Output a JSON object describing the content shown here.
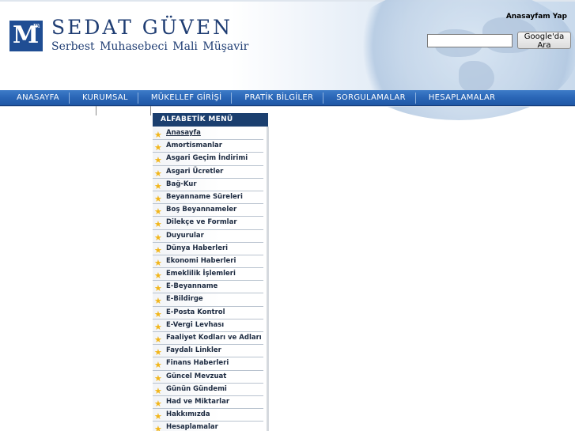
{
  "header": {
    "logo_letter": "M",
    "logo_sup": "m",
    "brand_name": "SEDAT GÜVEN",
    "tagline": "Serbest Muhasebeci Mali Müşavir",
    "homepage_link": "Anasayfam Yap",
    "search": {
      "value": "",
      "placeholder": "",
      "button_label": "Google'da Ara"
    }
  },
  "nav": {
    "items": [
      {
        "label": "ANASAYFA"
      },
      {
        "label": "KURUMSAL"
      },
      {
        "label": "MÜKELLEF GİRİŞİ"
      },
      {
        "label": "PRATİK BİLGİLER"
      },
      {
        "label": "SORGULAMALAR"
      },
      {
        "label": "HESAPLAMALAR"
      }
    ]
  },
  "menu": {
    "title": "ALFABETİK MENÜ",
    "items": [
      "Anasayfa",
      "Amortismanlar",
      "Asgari Geçim İndirimi",
      "Asgari Ücretler",
      "Bağ-Kur",
      "Beyanname Süreleri",
      "Boş Beyannameler",
      "Dilekçe ve Formlar",
      "Duyurular",
      "Dünya Haberleri",
      "Ekonomi Haberleri",
      "Emeklilik İşlemleri",
      "E-Beyanname",
      "E-Bildirge",
      "E-Posta Kontrol",
      "E-Vergi Levhası",
      "Faaliyet Kodları ve Adları",
      "Faydalı Linkler",
      "Finans Haberleri",
      "Güncel Mevzuat",
      "Günün Gündemi",
      "Had ve Miktarlar",
      "Hakkımızda",
      "Hesaplamalar"
    ]
  },
  "colors": {
    "brand": "#1f3d73",
    "nav": "#2a66b6",
    "menu_header": "#1b3f6f",
    "star": "#f2b61b"
  }
}
